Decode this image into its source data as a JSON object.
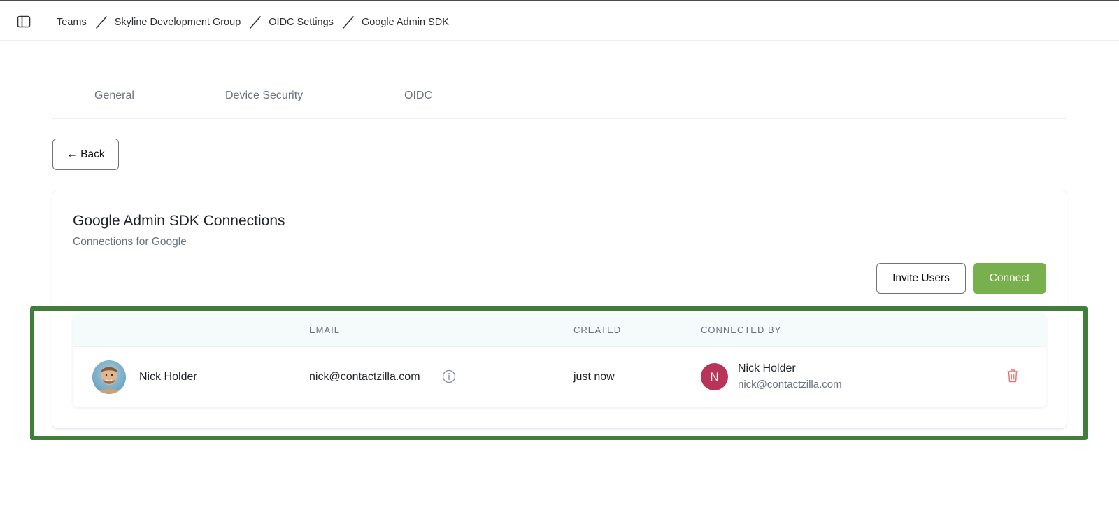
{
  "breadcrumb": {
    "items": [
      "Teams",
      "Skyline Development Group",
      "OIDC Settings",
      "Google Admin SDK"
    ]
  },
  "tabs": [
    {
      "label": "General"
    },
    {
      "label": "Device Security"
    },
    {
      "label": "OIDC"
    }
  ],
  "back_button": {
    "label": "← Back"
  },
  "card": {
    "title": "Google Admin SDK Connections",
    "subtitle": "Connections for Google",
    "invite_label": "Invite Users",
    "connect_label": "Connect"
  },
  "table": {
    "headers": {
      "email": "EMAIL",
      "created": "CREATED",
      "connected_by": "CONNECTED BY"
    },
    "rows": [
      {
        "name": "Nick Holder",
        "email": "nick@contactzilla.com",
        "created": "just now",
        "connected_by": {
          "initial": "N",
          "name": "Nick Holder",
          "email": "nick@contactzilla.com"
        }
      }
    ]
  },
  "colors": {
    "accent_green": "#77b04c",
    "highlight_border": "#3f7f3a",
    "initial_avatar": "#b8345a",
    "delete_red": "#e0797a"
  },
  "icons": {
    "sidebar_toggle": "sidebar-panel-icon",
    "info": "info-circle-icon",
    "delete": "trash-icon"
  }
}
